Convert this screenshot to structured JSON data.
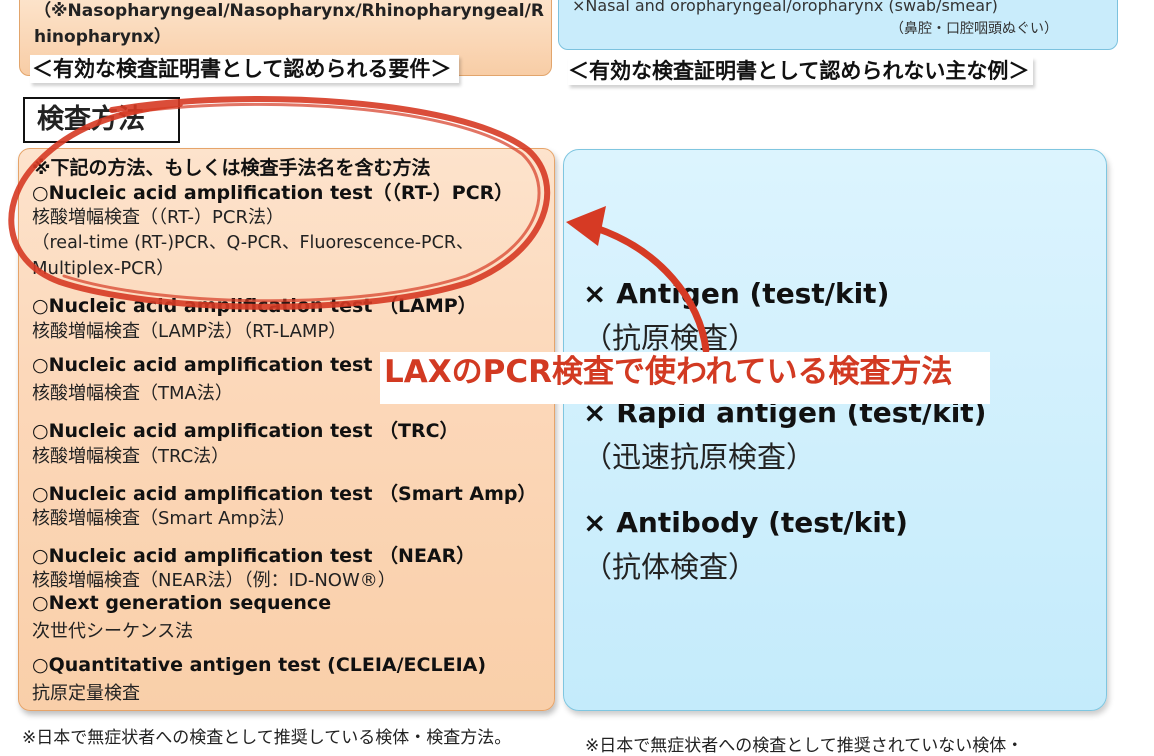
{
  "top": {
    "left_text": "（※Nasopharyngeal/Nasopharynx/Rhinopharyngeal/Rhinopharynx）",
    "right_text": "×Nasal and oropharyngeal/oropharynx (swab/smear)",
    "right_sub": "（鼻腔・口腔咽頭ぬぐい）"
  },
  "headings": {
    "left": "＜有効な検査証明書として認められる要件＞",
    "right": "＜有効な検査証明書として認められない主な例＞"
  },
  "method_title": "検査方法",
  "left_panel": {
    "note": "※下記の方法、もしくは検査手法名を含む方法",
    "pcr_title": "○Nucleic acid amplification test（（RT-）PCR）",
    "pcr_sub1": "核酸増幅検査（（RT-）PCR法）",
    "pcr_sub2": "（real-time (RT-)PCR、Q-PCR、Fluorescence-PCR、",
    "pcr_sub3": "Multiplex-PCR）",
    "lamp_title": "○Nucleic acid amplification test （LAMP）",
    "lamp_sub": "核酸増幅検査（LAMP法）（RT-LAMP）",
    "tma_title": "○Nucleic acid amplification test",
    "tma_sub": " 核酸増幅検査（TMA法）",
    "trc_title": "○Nucleic acid amplification test （TRC）",
    "trc_sub": "核酸増幅検査（TRC法）",
    "smart_title": "○Nucleic acid amplification test （Smart Amp）",
    "smart_sub": " 核酸増幅検査（Smart Amp法）",
    "near_title": "○Nucleic acid amplification test （NEAR）",
    "near_sub": "核酸増幅検査（NEAR法）（例：ID-NOW®）",
    "ngs_title": "○Next generation sequence",
    "ngs_sub": "次世代シーケンス法",
    "qat_title": "○Quantitative antigen test (CLEIA/ECLEIA)",
    "qat_sub": "抗原定量検査"
  },
  "right_panel": {
    "antigen": "× Antigen (test/kit)",
    "antigen_jp": "（抗原検査）",
    "rapid": "× Rapid antigen (test/kit)",
    "rapid_jp": "（迅速抗原検査）",
    "antibody": "× Antibody (test/kit)",
    "antibody_jp": "（抗体検査）"
  },
  "callout": "LAXのPCR検査で使われている検査方法",
  "footer": {
    "left": "※日本で無症状者への検査として推奨している検体・検査方法。",
    "right": "※日本で無症状者への検査として推奨されていない検体・"
  },
  "colors": {
    "annotation_red": "#d63a24",
    "left_panel_fill": "#fcd8ba",
    "right_panel_fill": "#c4ebfb"
  }
}
